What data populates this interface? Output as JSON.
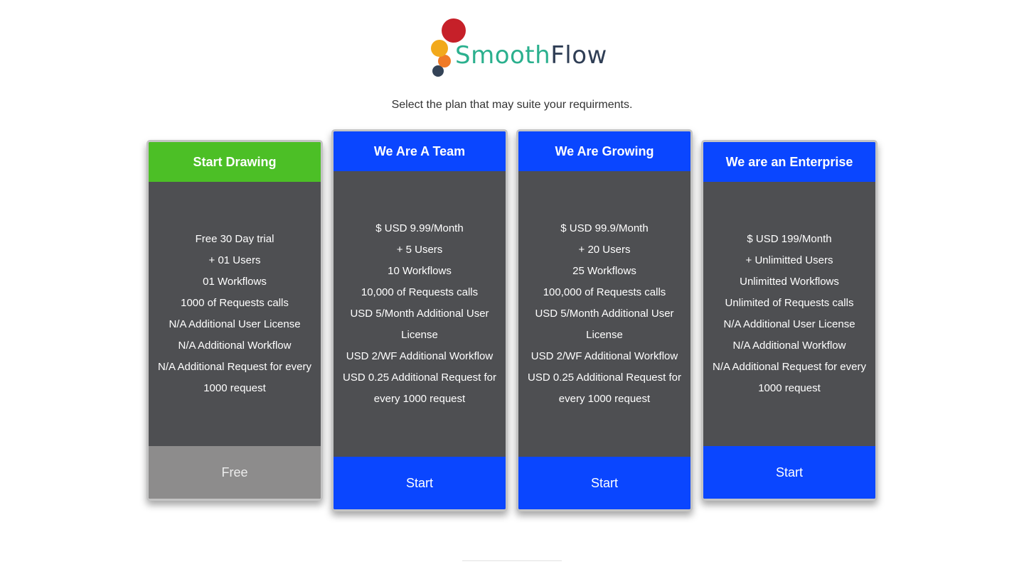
{
  "brand": {
    "word1": "Smooth",
    "word2": "Flow"
  },
  "subtitle": "Select the plan that may suite your requirments.",
  "colors": {
    "free_header": "#4cbf26",
    "paid_header": "#0a46ff",
    "card_body": "#4e4f52",
    "free_footer": "#8d8c8c"
  },
  "plans": [
    {
      "title": "Start Drawing",
      "features": [
        "Free 30 Day trial",
        "+ 01  Users",
        "01 Workflows",
        "1000 of Requests calls",
        "N/A Additional User License",
        "N/A Additional Workflow",
        "N/A Additional Request for every",
        "1000 request"
      ],
      "action": "Free"
    },
    {
      "title": "We Are A Team",
      "features": [
        "$ USD 9.99/Month",
        "+ 5  Users",
        "10 Workflows",
        "10,000 of Requests calls",
        "USD 5/Month Additional User",
        "License",
        "USD 2/WF Additional Workflow",
        "USD 0.25 Additional Request for",
        "every 1000 request"
      ],
      "action": "Start"
    },
    {
      "title": "We Are Growing",
      "features": [
        "$ USD 99.9/Month",
        "+ 20  Users",
        "25 Workflows",
        "100,000 of Requests calls",
        "USD 5/Month Additional User",
        "License",
        "USD 2/WF Additional Workflow",
        "USD 0.25 Additional Request for",
        "every 1000 request"
      ],
      "action": "Start"
    },
    {
      "title": "We are an Enterprise",
      "features": [
        "$ USD 199/Month",
        "+ Unlimitted  Users",
        "Unlimitted Workflows",
        "Unlimited of Requests calls",
        "N/A Additional User License",
        "N/A Additional Workflow",
        "N/A Additional Request for every",
        "1000 request"
      ],
      "action": "Start"
    }
  ]
}
